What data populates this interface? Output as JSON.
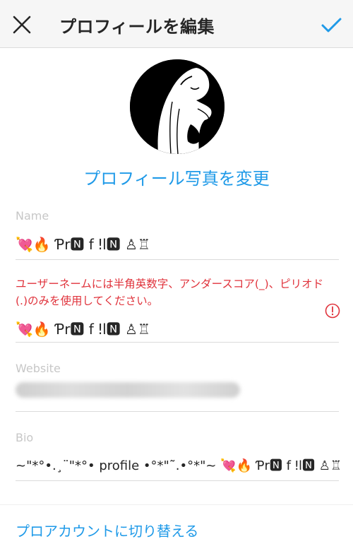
{
  "header": {
    "title": "プロフィールを編集",
    "close_icon": "close-icon",
    "done_icon": "checkmark-icon"
  },
  "profile": {
    "avatar": "profile-avatar-illustration",
    "change_photo_label": "プロフィール写真を変更"
  },
  "fields": {
    "name": {
      "label": "Name",
      "value": "💘🔥 Ƥr🅽 f ǃl🅽 ♙♖"
    },
    "username": {
      "error": "ユーザーネームには半角英数字、アンダースコア(_)、ピリオド(.)のみを使用してください。",
      "error_icon": "alert-circle-icon",
      "value": "💘🔥 Ƥr🅽 f ǃl🅽 ♙♖"
    },
    "website": {
      "label": "Website"
    },
    "bio": {
      "label": "Bio",
      "value": "~\"*°•.¸¨\"*°• profile •°*\"˜.•°*\"~ 💘🔥 Ƥr🅽 f ǃl🅽 ♙♖"
    }
  },
  "footer": {
    "switch_account_label": "プロアカウントに切り替える"
  },
  "colors": {
    "accent": "#1f9ae8",
    "error": "#e0333c",
    "label": "#c7c7c7",
    "divider": "#dbdbdb",
    "header_bg": "#f6f6f6"
  }
}
